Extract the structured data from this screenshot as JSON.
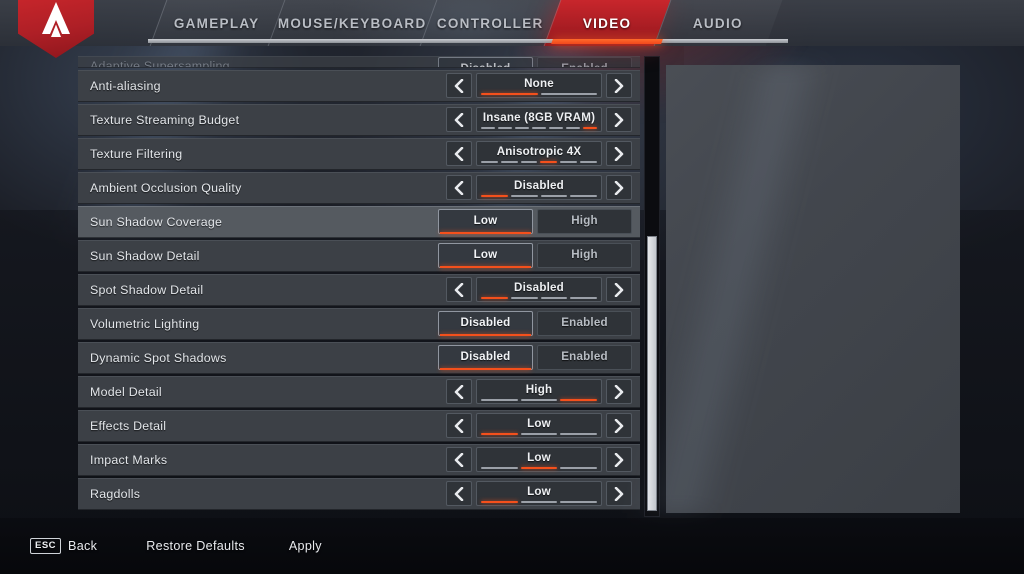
{
  "app": {
    "logo_name": "apex-legends-logo",
    "accent_orange": "#f4501c",
    "accent_red": "#ae1f26",
    "row_bg": "#3c4046",
    "row_highlight_bg": "#555a60"
  },
  "nav": {
    "tabs": [
      {
        "label": "GAMEPLAY",
        "active": false
      },
      {
        "label": "MOUSE/KEYBOARD",
        "active": false
      },
      {
        "label": "CONTROLLER",
        "active": false
      },
      {
        "label": "VIDEO",
        "active": true
      },
      {
        "label": "AUDIO",
        "active": false
      }
    ]
  },
  "settings": {
    "rows": [
      {
        "label": "Adaptive Supersampling",
        "type": "toggle",
        "clipped": true,
        "highlight": false,
        "options": [
          "Disabled",
          "Enabled"
        ],
        "value": "Disabled"
      },
      {
        "label": "Anti-aliasing",
        "type": "stepper",
        "clipped": false,
        "highlight": false,
        "value": "None",
        "segments": 2,
        "active_segment": 1
      },
      {
        "label": "Texture Streaming Budget",
        "type": "stepper",
        "clipped": false,
        "highlight": false,
        "value": "Insane (8GB VRAM)",
        "segments": 7,
        "active_segment": 7
      },
      {
        "label": "Texture Filtering",
        "type": "stepper",
        "clipped": false,
        "highlight": false,
        "value": "Anisotropic 4X",
        "segments": 6,
        "active_segment": 4
      },
      {
        "label": "Ambient Occlusion Quality",
        "type": "stepper",
        "clipped": false,
        "highlight": false,
        "value": "Disabled",
        "segments": 4,
        "active_segment": 1
      },
      {
        "label": "Sun Shadow Coverage",
        "type": "toggle",
        "clipped": false,
        "highlight": true,
        "options": [
          "Low",
          "High"
        ],
        "value": "Low"
      },
      {
        "label": "Sun Shadow Detail",
        "type": "toggle",
        "clipped": false,
        "highlight": false,
        "options": [
          "Low",
          "High"
        ],
        "value": "Low"
      },
      {
        "label": "Spot Shadow Detail",
        "type": "stepper",
        "clipped": false,
        "highlight": false,
        "value": "Disabled",
        "segments": 4,
        "active_segment": 1
      },
      {
        "label": "Volumetric Lighting",
        "type": "toggle",
        "clipped": false,
        "highlight": false,
        "options": [
          "Disabled",
          "Enabled"
        ],
        "value": "Disabled"
      },
      {
        "label": "Dynamic Spot Shadows",
        "type": "toggle",
        "clipped": false,
        "highlight": false,
        "options": [
          "Disabled",
          "Enabled"
        ],
        "value": "Disabled"
      },
      {
        "label": "Model Detail",
        "type": "stepper",
        "clipped": false,
        "highlight": false,
        "value": "High",
        "segments": 3,
        "active_segment": 3
      },
      {
        "label": "Effects Detail",
        "type": "stepper",
        "clipped": false,
        "highlight": false,
        "value": "Low",
        "segments": 3,
        "active_segment": 1
      },
      {
        "label": "Impact Marks",
        "type": "stepper",
        "clipped": false,
        "highlight": false,
        "value": "Low",
        "segments": 3,
        "active_segment": 2
      },
      {
        "label": "Ragdolls",
        "type": "stepper",
        "clipped": false,
        "highlight": false,
        "value": "Low",
        "segments": 3,
        "active_segment": 1
      }
    ]
  },
  "scrollbar": {
    "thumb_top_pct": 39,
    "thumb_height_pct": 60
  },
  "footer": {
    "back_key": "ESC",
    "back_label": "Back",
    "restore_label": "Restore Defaults",
    "apply_label": "Apply"
  }
}
